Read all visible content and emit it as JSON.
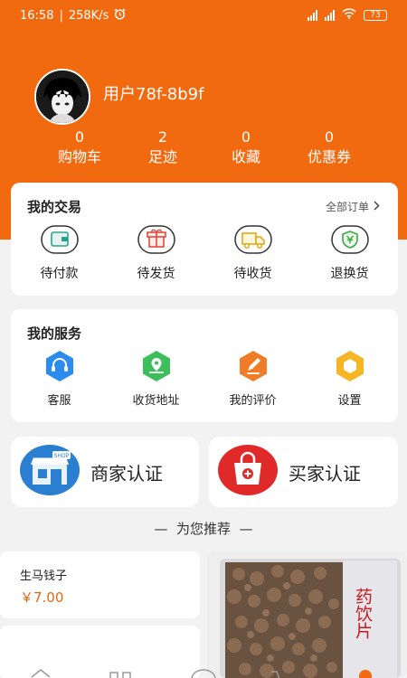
{
  "status": {
    "time": "16:58",
    "speed": "258K/s",
    "battery": "73"
  },
  "profile": {
    "username": "用户78f-8b9f"
  },
  "stats": [
    {
      "value": "0",
      "label": "购物车"
    },
    {
      "value": "2",
      "label": "足迹"
    },
    {
      "value": "0",
      "label": "收藏"
    },
    {
      "value": "0",
      "label": "优惠券"
    }
  ],
  "trade": {
    "title": "我的交易",
    "all_orders": "全部订单",
    "items": [
      {
        "label": "待付款",
        "icon": "wallet-icon"
      },
      {
        "label": "待发货",
        "icon": "gift-icon"
      },
      {
        "label": "待收货",
        "icon": "truck-icon"
      },
      {
        "label": "退换货",
        "icon": "return-shield-icon"
      }
    ]
  },
  "services": {
    "title": "我的服务",
    "items": [
      {
        "label": "客服",
        "icon": "headset-icon",
        "color": "#2b8cf0"
      },
      {
        "label": "收货地址",
        "icon": "location-icon",
        "color": "#3cbf5a"
      },
      {
        "label": "我的评价",
        "icon": "edit-icon",
        "color": "#f07c28"
      },
      {
        "label": "设置",
        "icon": "hexagon-settings-icon",
        "color": "#f5b525"
      }
    ]
  },
  "certification": {
    "merchant": "商家认证",
    "buyer": "买家认证",
    "shop_sign": "SHOP"
  },
  "recommend": {
    "title": "为您推荐",
    "product": {
      "name": "生马钱子",
      "price": "￥7.00"
    },
    "image_text": "药饮片"
  },
  "colors": {
    "brand": "#f26a10",
    "price": "#e8650f"
  }
}
